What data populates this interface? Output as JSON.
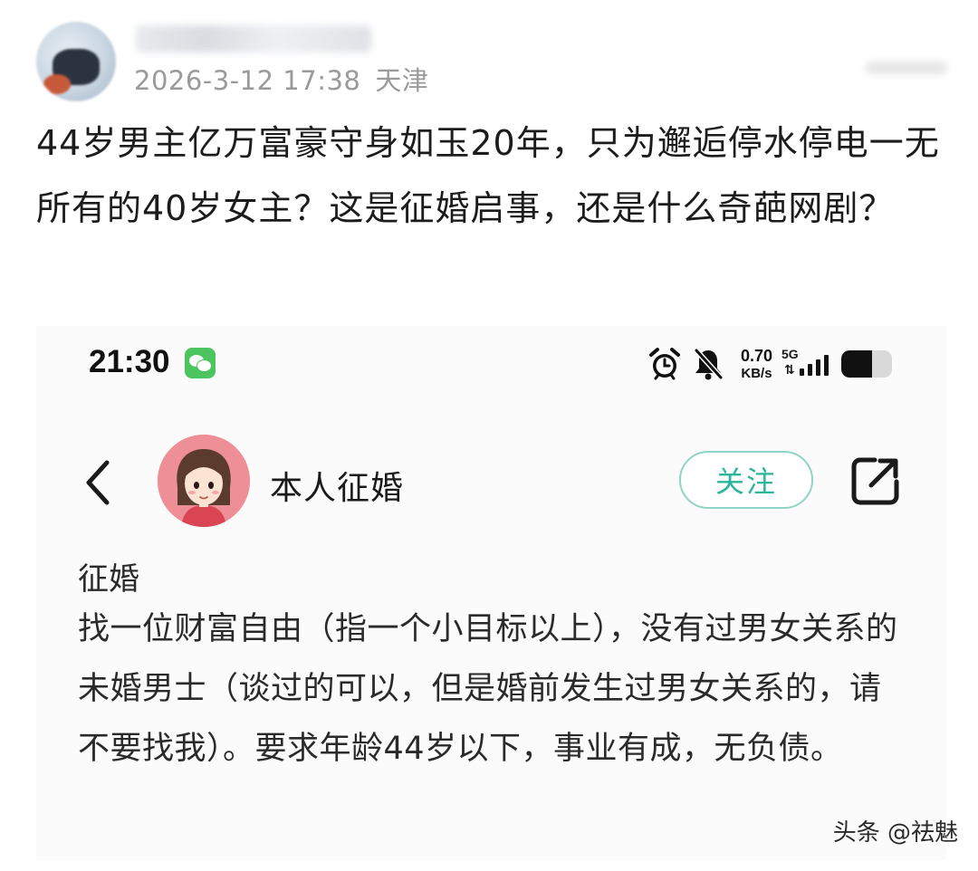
{
  "post": {
    "username_blurred": "",
    "timestamp": "2026-3-12 17:38",
    "location": "天津",
    "text": "44岁男主亿万富豪守身如玉20年，只为邂逅停水停电一无所有的40岁女主？这是征婚启事，还是什么奇葩网剧？"
  },
  "screenshot": {
    "status_bar": {
      "time": "21:30",
      "network_speed_value": "0.70",
      "network_speed_unit": "KB/s",
      "network_type": "5G",
      "signal_bars": 4,
      "battery_level": 0.6,
      "icons": [
        "wechat-icon",
        "alarm-icon",
        "bell-muted-icon",
        "signal-icon",
        "battery-icon"
      ]
    },
    "profile": {
      "name": "本人征婚",
      "follow_label": "关注",
      "accent_color": "#2bb59a"
    },
    "content": {
      "title": "征婚",
      "body": "找一位财富自由（指一个小目标以上），没有过男女关系的未婚男士（谈过的可以，但是婚前发生过男女关系的，请不要找我）。要求年龄44岁以下，事业有成，无负债。"
    }
  },
  "watermark": "头条 @祛魅"
}
